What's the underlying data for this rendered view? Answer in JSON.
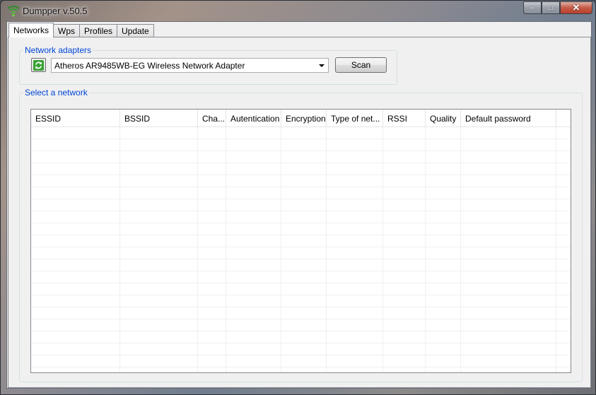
{
  "window": {
    "title": "Dumpper v.50.5"
  },
  "caption_buttons": {
    "minimize": "–",
    "maximize": "□",
    "close": "✕"
  },
  "tabs": [
    {
      "label": "Networks",
      "active": true
    },
    {
      "label": "Wps",
      "active": false
    },
    {
      "label": "Profiles",
      "active": false
    },
    {
      "label": "Update",
      "active": false
    }
  ],
  "adapters_group": {
    "legend": "Network adapters",
    "selected_adapter": "Atheros AR9485WB-EG Wireless Network Adapter",
    "scan_label": "Scan",
    "refresh_icon": "refresh-icon"
  },
  "networks_group": {
    "legend": "Select a network",
    "columns": [
      "ESSID",
      "BSSID",
      "Cha...",
      "Autentication",
      "Encryption",
      "Type of net...",
      "RSSI",
      "Quality",
      "Default password"
    ],
    "rows": []
  },
  "colors": {
    "legend": "#0046d5",
    "accent_green": "#3aa335"
  }
}
